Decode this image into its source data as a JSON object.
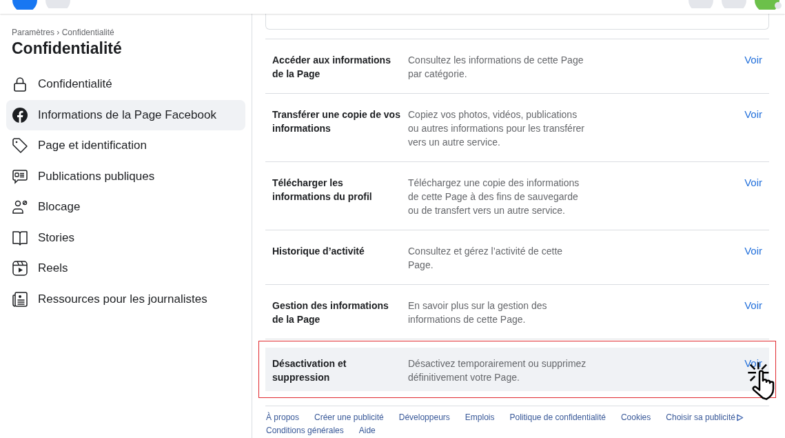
{
  "sidebar": {
    "breadcrumb": "Paramètres › Confidentialité",
    "title": "Confidentialité",
    "items": [
      {
        "label": "Confidentialité",
        "selected": false
      },
      {
        "label": "Informations de la Page Facebook",
        "selected": true
      },
      {
        "label": "Page et identification",
        "selected": false
      },
      {
        "label": "Publications publiques",
        "selected": false
      },
      {
        "label": "Blocage",
        "selected": false
      },
      {
        "label": "Stories",
        "selected": false
      },
      {
        "label": "Reels",
        "selected": false
      },
      {
        "label": "Ressources pour les journalistes",
        "selected": false
      }
    ]
  },
  "settings": [
    {
      "title": "Accéder aux informations de la Page",
      "description": "Consultez les informations de cette Page par catégorie.",
      "action": "Voir",
      "selected": false
    },
    {
      "title": "Transférer une copie de vos informations",
      "description": "Copiez vos photos, vidéos, publications ou autres informations pour les transférer vers un autre service.",
      "action": "Voir",
      "selected": false
    },
    {
      "title": "Télécharger les informations du profil",
      "description": "Téléchargez une copie des informations de cette Page à des fins de sauvegarde ou de transfert vers un autre service.",
      "action": "Voir",
      "selected": false
    },
    {
      "title": "Historique d’activité",
      "description": "Consultez et gérez l’activité de cette Page.",
      "action": "Voir",
      "selected": false
    },
    {
      "title": "Gestion des informations de la Page",
      "description": "En savoir plus sur la gestion des informations de cette Page.",
      "action": "Voir",
      "selected": false
    },
    {
      "title": "Désactivation et suppression",
      "description": "Désactivez temporairement ou supprimez définitivement votre Page.",
      "action": "Voir",
      "selected": true
    }
  ],
  "footer_links": [
    "À propos",
    "Créer une publicité",
    "Développeurs",
    "Emplois",
    "Politique de confidentialité",
    "Cookies",
    "Choisir sa publicité",
    "Conditions générales",
    "Aide"
  ]
}
